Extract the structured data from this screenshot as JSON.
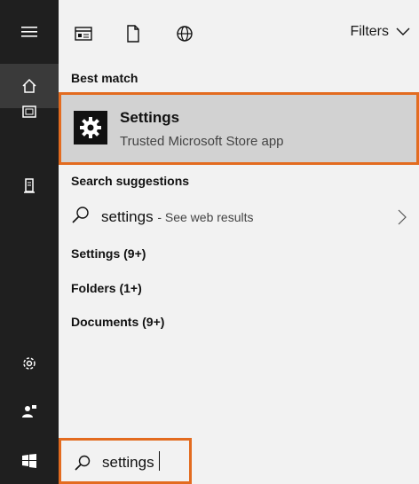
{
  "toolbar": {
    "filters_label": "Filters"
  },
  "sections": {
    "best_match": "Best match",
    "search_suggestions": "Search suggestions"
  },
  "best_match": {
    "title": "Settings",
    "subtitle": "Trusted Microsoft Store app"
  },
  "suggestion": {
    "query": "settings",
    "suffix": "- See web results"
  },
  "categories": [
    {
      "label": "Settings (9+)"
    },
    {
      "label": "Folders (1+)"
    },
    {
      "label": "Documents (9+)"
    }
  ],
  "search": {
    "value": "settings"
  },
  "colors": {
    "highlight_border": "#e36b1f",
    "rail_bg": "#1f1f1f"
  }
}
